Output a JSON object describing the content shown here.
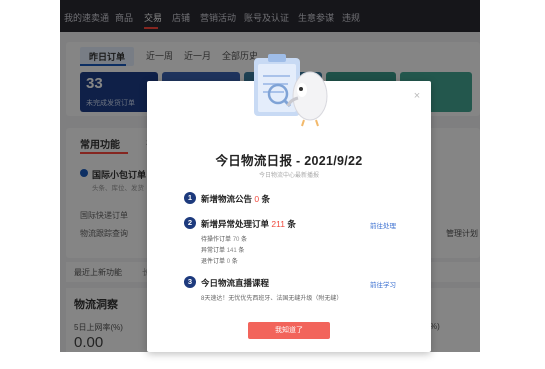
{
  "nav": {
    "items": [
      "我的速卖通",
      "商品",
      "交易",
      "店铺",
      "营销活动",
      "账号及认证",
      "生意参谋",
      "违规"
    ],
    "active_index": 2
  },
  "orders": {
    "tabs": [
      "昨日订单",
      "近一周",
      "近一月",
      "全部历史"
    ],
    "active_tab": "昨日订单",
    "stat_value": "33",
    "stat_label": "未完成发货订单"
  },
  "functions": {
    "title": "常用功能",
    "tab2": "在",
    "item_main": "国际小包订单",
    "item_desc": "头条、库位、发货",
    "rows": [
      "国际快递订单",
      "物流跟踪查询"
    ],
    "right_link": "管理计划"
  },
  "quick": {
    "label": "最近上新功能",
    "more": "长"
  },
  "insight": {
    "title": "物流洞察",
    "label": "5日上网率(%)",
    "value": "0.00",
    "pct": "%)"
  },
  "modal": {
    "title": "今日物流日报 - 2021/9/22",
    "subtitle": "今日物流中心最新播报",
    "close": "×",
    "sections": [
      {
        "num": "1",
        "title": "新增物流公告",
        "count": "0",
        "unit": "条"
      },
      {
        "num": "2",
        "title": "新增异常处理订单",
        "count": "211",
        "unit": "条",
        "link": "前往处理",
        "lines": [
          {
            "label": "待操作订单",
            "count": "70",
            "unit": "条"
          },
          {
            "label": "异常订单",
            "count": "141",
            "unit": "条"
          },
          {
            "label": "退件订单",
            "count": "0",
            "unit": "条"
          }
        ]
      },
      {
        "num": "3",
        "title": "今日物流直播课程",
        "link": "前往学习",
        "desc": "8天速达！无忧优先西班牙、法国无缝升级（附无缝）"
      }
    ],
    "button": "我知道了"
  },
  "colors": {
    "accent_red": "#f2645b",
    "badge_navy": "#1d3a7d",
    "link_blue": "#3a6fd0"
  }
}
